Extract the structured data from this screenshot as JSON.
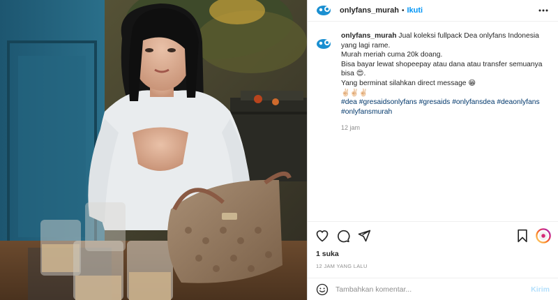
{
  "header": {
    "username": "onlyfans_murah",
    "separator": "•",
    "follow_label": "Ikuti"
  },
  "caption": {
    "username": "onlyfans_murah",
    "lines": [
      "Jual koleksi fullpack Dea onlyfans Indonesia yang lagi rame.",
      "Murah meriah cuma 20k doang.",
      "Bisa bayar lewat shopeepay atau dana atau transfer semuanya bisa 😍.",
      "Yang berminat silahkan direct message 😁",
      "✌🏻✌🏻✌🏻"
    ],
    "hashtags": [
      "#dea",
      "#gresaidsonlyfans",
      "#gresaids",
      "#onlyfansdea",
      "#deaonlyfans",
      "#onlyfansmurah"
    ],
    "time": "12 jam"
  },
  "actions": {
    "like_icon": "heart-icon",
    "comment_icon": "comment-icon",
    "share_icon": "share-icon",
    "save_icon": "bookmark-icon"
  },
  "likes": "1 suka",
  "timeago": "12 JAM YANG LALU",
  "comment": {
    "placeholder": "Tambahkan komentar...",
    "post_label": "Kirim"
  },
  "colors": {
    "accent": "#0095f6",
    "link": "#00376b",
    "post_disabled": "#b2dffc"
  }
}
